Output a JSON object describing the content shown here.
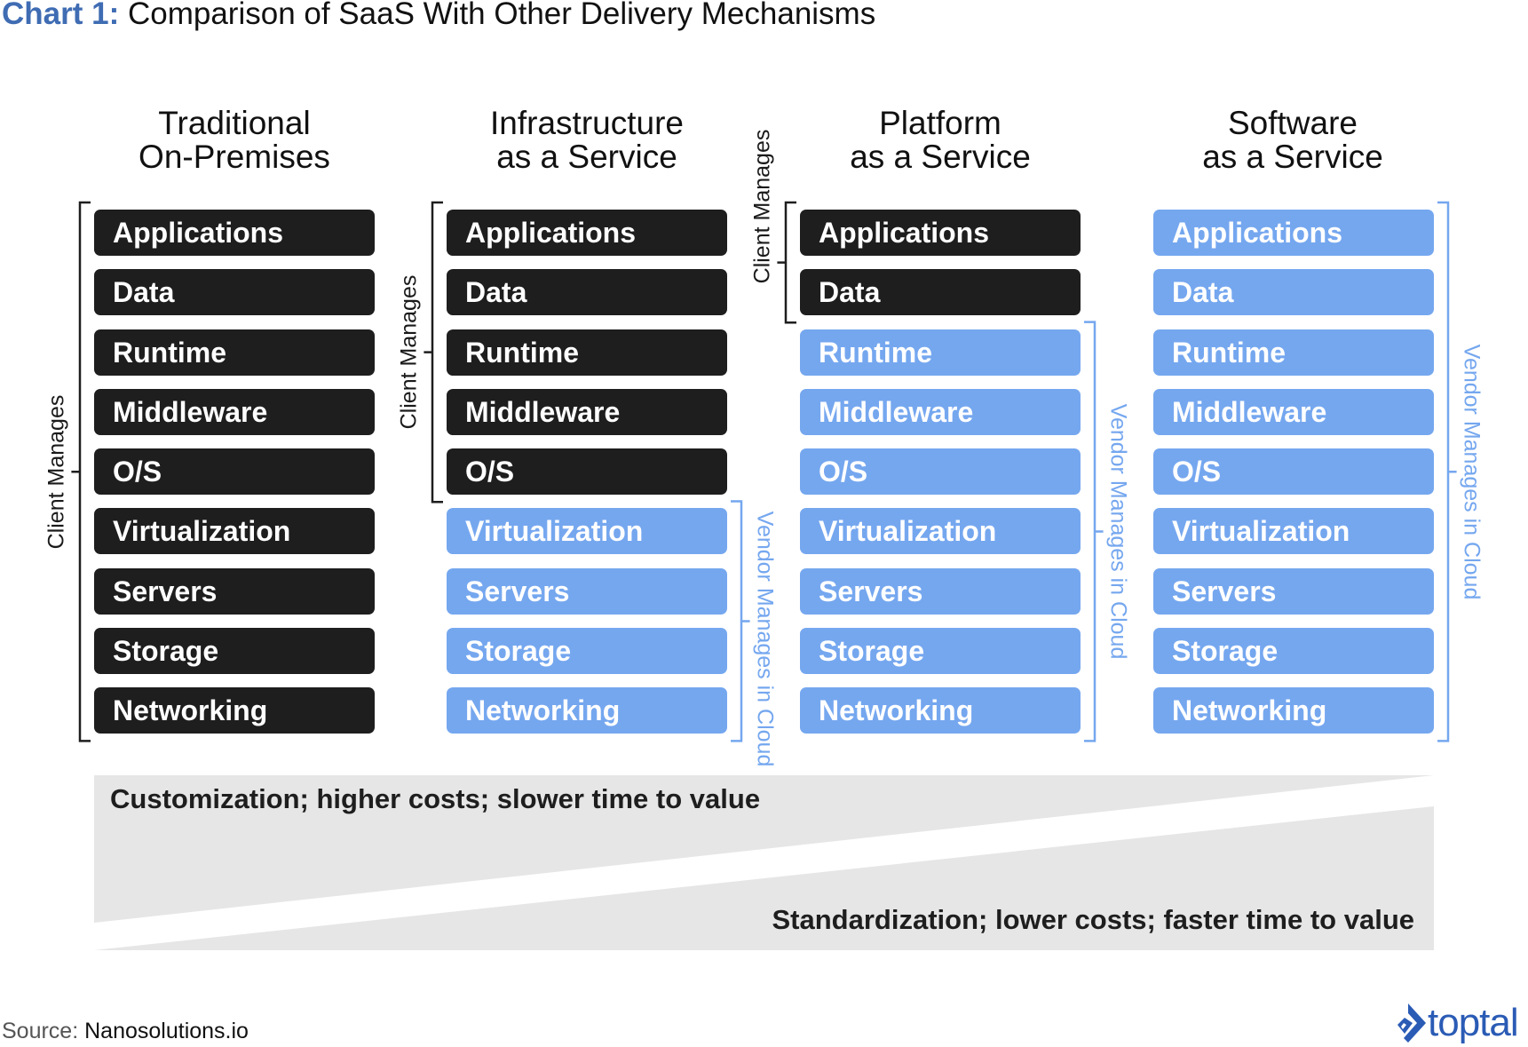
{
  "title": {
    "lead": "Chart 1:",
    "rest": " Comparison of SaaS With Other Delivery Mechanisms"
  },
  "colors": {
    "client": "#1e1e1e",
    "vendor": "#75a7ef",
    "title_accent": "#3f6cb3",
    "band": "#e6e6e6",
    "logo": "#2a5bb5"
  },
  "columns": [
    {
      "header": [
        "Traditional",
        "On-Premises"
      ],
      "client_count": 9,
      "layers": [
        "Applications",
        "Data",
        "Runtime",
        "Middleware",
        "O/S",
        "Virtualization",
        "Servers",
        "Storage",
        "Networking"
      ],
      "client_label": "Client Manages",
      "vendor_label": ""
    },
    {
      "header": [
        "Infrastructure",
        "as a Service"
      ],
      "client_count": 5,
      "layers": [
        "Applications",
        "Data",
        "Runtime",
        "Middleware",
        "O/S",
        "Virtualization",
        "Servers",
        "Storage",
        "Networking"
      ],
      "client_label": "Client Manages",
      "vendor_label": "Vendor Manages in Cloud"
    },
    {
      "header": [
        "Platform",
        "as a Service"
      ],
      "client_count": 2,
      "layers": [
        "Applications",
        "Data",
        "Runtime",
        "Middleware",
        "O/S",
        "Virtualization",
        "Servers",
        "Storage",
        "Networking"
      ],
      "client_label": "Client Manages",
      "vendor_label": "Vendor Manages in Cloud"
    },
    {
      "header": [
        "Software",
        "as a  Service"
      ],
      "client_count": 0,
      "layers": [
        "Applications",
        "Data",
        "Runtime",
        "Middleware",
        "O/S",
        "Virtualization",
        "Servers",
        "Storage",
        "Networking"
      ],
      "client_label": "",
      "vendor_label": "Vendor Manages in Cloud"
    }
  ],
  "band": {
    "top_text": "Customization; higher costs; slower time to value",
    "bottom_text": "Standardization; lower costs; faster time to value"
  },
  "source": {
    "key": "Source:",
    "value": "Nanosolutions.io"
  },
  "logo": {
    "word": "toptal",
    "icon": "toptal-diamond-icon"
  }
}
